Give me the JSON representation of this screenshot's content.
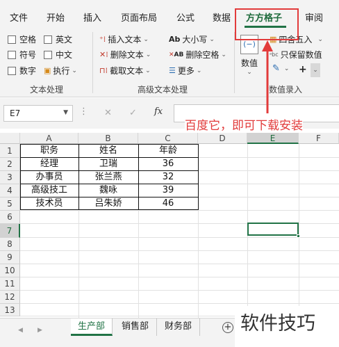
{
  "ribbon_tabs": [
    "文件",
    "开始",
    "插入",
    "页面布局",
    "公式",
    "数据",
    "方方格子",
    "审阅"
  ],
  "active_tab": "方方格子",
  "text_group": {
    "checkboxes": [
      "空格",
      "英文",
      "符号",
      "中文",
      "数字"
    ],
    "exec_label": "执行",
    "label": "文本处理"
  },
  "adv_group": {
    "insert_text": "插入文本",
    "delete_text": "删除文本",
    "extract_text": "截取文本",
    "case": "大小写",
    "delete_space": "删除空格",
    "more": "更多",
    "label": "高级文本处理",
    "case_icon": "Ab",
    "delete_space_icon": "AB"
  },
  "num_group": {
    "value_label": "数值",
    "round_label": "四舍五入",
    "keep_value": "只保留数值",
    "plus": "+",
    "label": "数值录入"
  },
  "name_box": "E7",
  "fx_label": "fx",
  "annotation": "百度它，即可下载安装",
  "columns": [
    "A",
    "B",
    "C",
    "D",
    "E",
    "F"
  ],
  "selected_column": "E",
  "rows": [
    "1",
    "2",
    "3",
    "4",
    "5",
    "6",
    "7",
    "8",
    "9",
    "10",
    "11",
    "12",
    "13"
  ],
  "selected_row": "7",
  "table": [
    [
      "职务",
      "姓名",
      "年龄"
    ],
    [
      "经理",
      "卫瑞",
      "36"
    ],
    [
      "办事员",
      "张兰燕",
      "32"
    ],
    [
      "高级技工",
      "魏咏",
      "39"
    ],
    [
      "技术员",
      "吕朱娇",
      "46"
    ]
  ],
  "sheets": [
    "生产部",
    "销售部",
    "财务部"
  ],
  "active_sheet": "生产部",
  "watermark": "软件技巧",
  "colors": {
    "accent": "#217346",
    "annotation": "#e23b3b"
  }
}
